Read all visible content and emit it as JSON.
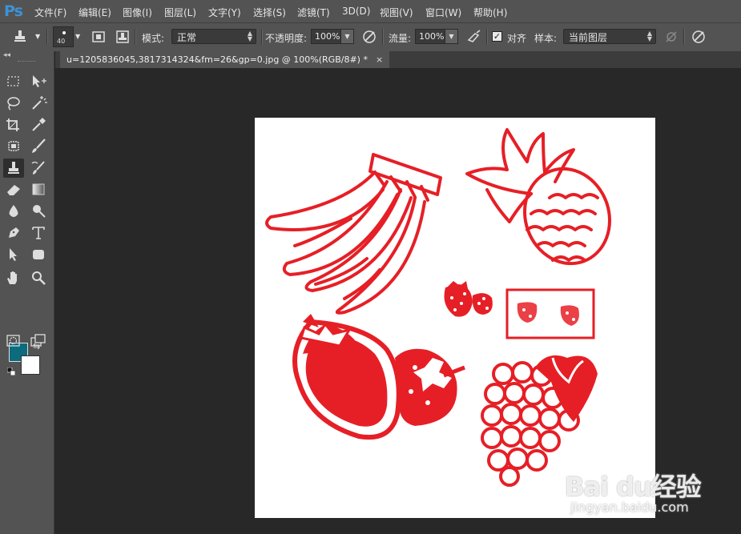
{
  "app": {
    "logo": "Ps"
  },
  "menu": [
    "文件(F)",
    "编辑(E)",
    "图像(I)",
    "图层(L)",
    "文字(Y)",
    "选择(S)",
    "滤镜(T)",
    "3D(D)",
    "视图(V)",
    "窗口(W)",
    "帮助(H)"
  ],
  "options": {
    "brush_size": "40",
    "mode_label": "模式:",
    "mode_value": "正常",
    "opacity_label": "不透明度:",
    "opacity_value": "100%",
    "flow_label": "流量:",
    "flow_value": "100%",
    "aligned_label": "对齐",
    "aligned_checked": true,
    "sample_label": "样本:",
    "sample_value": "当前图层"
  },
  "toolbox": {
    "collapse": "◂◂",
    "foreground_color": "#0d6b7e",
    "background_color": "#ffffff"
  },
  "document": {
    "tab_title": "u=1205836045,3817314324&fm=26&gp=0.jpg @ 100%(RGB/8#) *",
    "close": "×"
  },
  "artwork": {
    "stroke_color": "#e61f26"
  },
  "watermark": {
    "logo": "Bai du经验",
    "url": "jingyan.baidu.com"
  }
}
